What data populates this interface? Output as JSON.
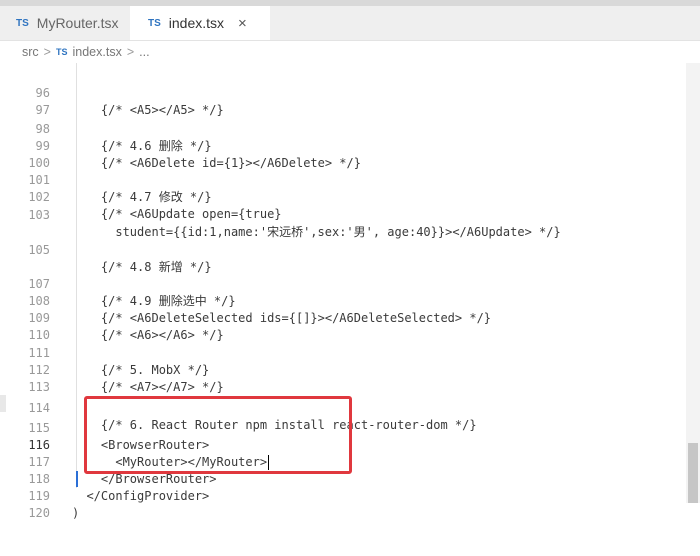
{
  "tabs": [
    {
      "icon": "TS",
      "label": "MyRouter.tsx",
      "active": false
    },
    {
      "icon": "TS",
      "label": "index.tsx",
      "active": true,
      "close": "×"
    }
  ],
  "breadcrumb": {
    "root": "src",
    "sep1": ">",
    "icon": "TS",
    "file": "index.tsx",
    "sep2": ">",
    "more": "..."
  },
  "editor": {
    "lines": [
      {
        "n": "96",
        "text": "    {/* <A5></A5> */}"
      },
      {
        "n": "97",
        "text": ""
      },
      {
        "n": "98",
        "text": "    {/* 4.6 删除 */}"
      },
      {
        "n": "99",
        "text": "    {/* <A6Delete id={1}></A6Delete> */}"
      },
      {
        "n": "100",
        "text": ""
      },
      {
        "n": "101",
        "text": "    {/* 4.7 修改 */}"
      },
      {
        "n": "102",
        "text": "    {/* <A6Update open={true}"
      },
      {
        "n": "103",
        "text": "      student={{id:1,name:'宋远桥',sex:'男', age:40}}></A6Update> */}"
      },
      {
        "n": "105",
        "text": "    {/* 4.8 新增 */}"
      },
      {
        "n": "107",
        "text": "    {/* 4.9 删除选中 */}"
      },
      {
        "n": "108",
        "text": "    {/* <A6DeleteSelected ids={[]}></A6DeleteSelected> */}"
      },
      {
        "n": "109",
        "text": "    {/* <A6></A6> */}"
      },
      {
        "n": "110",
        "text": ""
      },
      {
        "n": "111",
        "text": "    {/* 5. MobX */}"
      },
      {
        "n": "112",
        "text": "    {/* <A7></A7> */}"
      },
      {
        "n": "113",
        "text": ""
      },
      {
        "n": "114",
        "text": "    {/* 6. React Router npm install react-router-dom */}"
      },
      {
        "n": "115",
        "text": "    <BrowserRouter>"
      },
      {
        "n": "116",
        "text": "      <MyRouter></MyRouter>"
      },
      {
        "n": "117",
        "text": "    </BrowserRouter>"
      },
      {
        "n": "118",
        "text": "  </ConfigProvider>"
      },
      {
        "n": "119",
        "text": ")"
      },
      {
        "n": "120",
        "text": ""
      }
    ]
  }
}
